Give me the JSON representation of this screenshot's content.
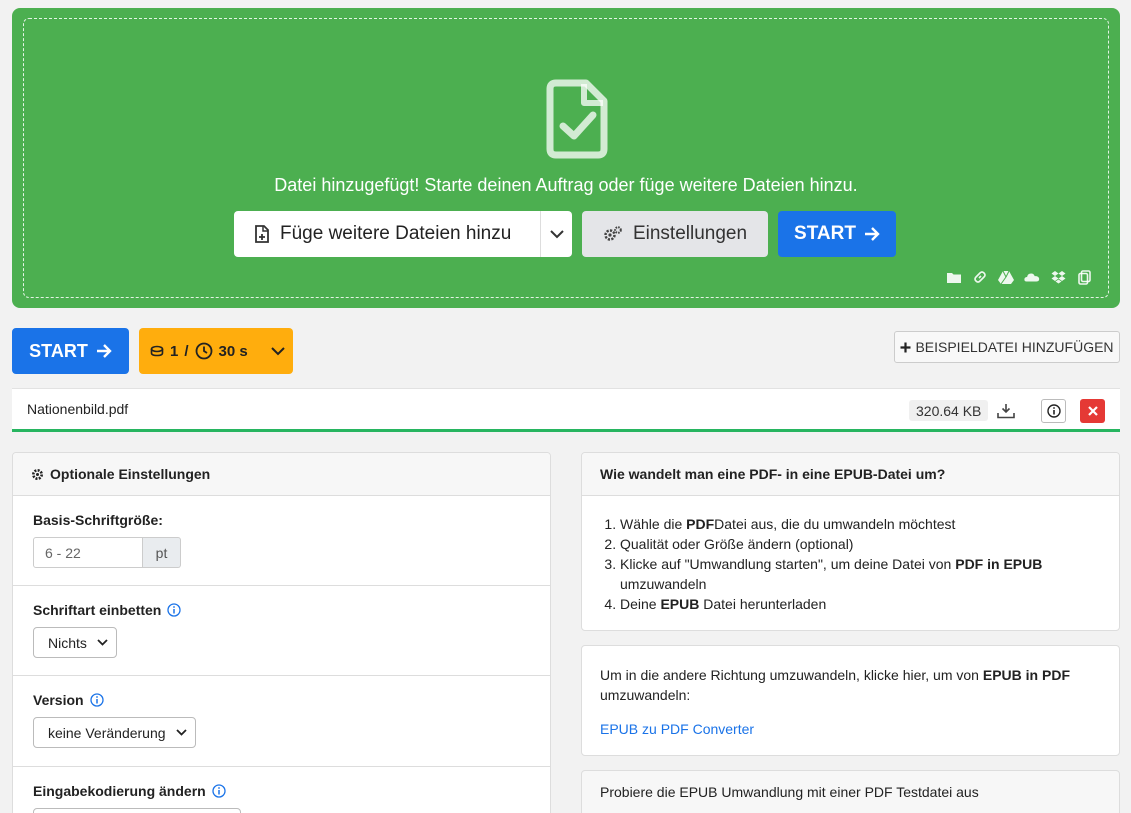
{
  "dropzone": {
    "message": "Datei hinzugefügt! Starte deinen Auftrag oder füge weitere Dateien hinzu.",
    "add_files_label": "Füge weitere Dateien hinzu",
    "settings_label": "Einstellungen",
    "start_label": "START",
    "sources": [
      "folder-icon",
      "link-icon",
      "google-drive-icon",
      "onedrive-icon",
      "dropbox-icon",
      "clipboard-icon"
    ],
    "background_color": "#4caf50"
  },
  "toolbar": {
    "start_label": "START",
    "credits_count": "1",
    "credits_sep": "/",
    "time_label": "30 s",
    "sample_label": "BEISPIELDATEI HINZUFÜGEN",
    "start_color": "#1a73e8",
    "credits_color": "#ffad0d"
  },
  "file": {
    "name": "Nationenbild.pdf",
    "size": "320.64 KB"
  },
  "settings": {
    "title": "Optionale Einstellungen",
    "font_size": {
      "label": "Basis-Schriftgröße:",
      "placeholder": "6 - 22",
      "unit": "pt"
    },
    "embed_font": {
      "label": "Schriftart einbetten",
      "value": "Nichts"
    },
    "version": {
      "label": "Version",
      "value": "keine Veränderung"
    },
    "encoding": {
      "label": "Eingabekodierung ändern"
    }
  },
  "howto": {
    "title": "Wie wandelt man eine PDF- in eine EPUB-Datei um?",
    "steps": [
      {
        "pre": "Wähle die ",
        "bold": "PDF",
        "post": "Datei aus, die du umwandeln möchtest"
      },
      {
        "text": "Qualität oder Größe ändern (optional)"
      },
      {
        "pre": "Klicke auf \"Umwandlung starten\", um deine Datei von ",
        "bold": "PDF in EPUB",
        "post": " umzuwandeln"
      },
      {
        "pre": "Deine ",
        "bold": "EPUB",
        "post": " Datei herunterladen"
      }
    ]
  },
  "reverse": {
    "pre": "Um in die andere Richtung umzuwandeln, klicke hier, um von ",
    "bold": "EPUB in PDF",
    "post": " umzuwandeln:",
    "link": "EPUB zu PDF Converter"
  },
  "test": {
    "text": "Probiere die EPUB Umwandlung mit einer PDF Testdatei aus"
  }
}
